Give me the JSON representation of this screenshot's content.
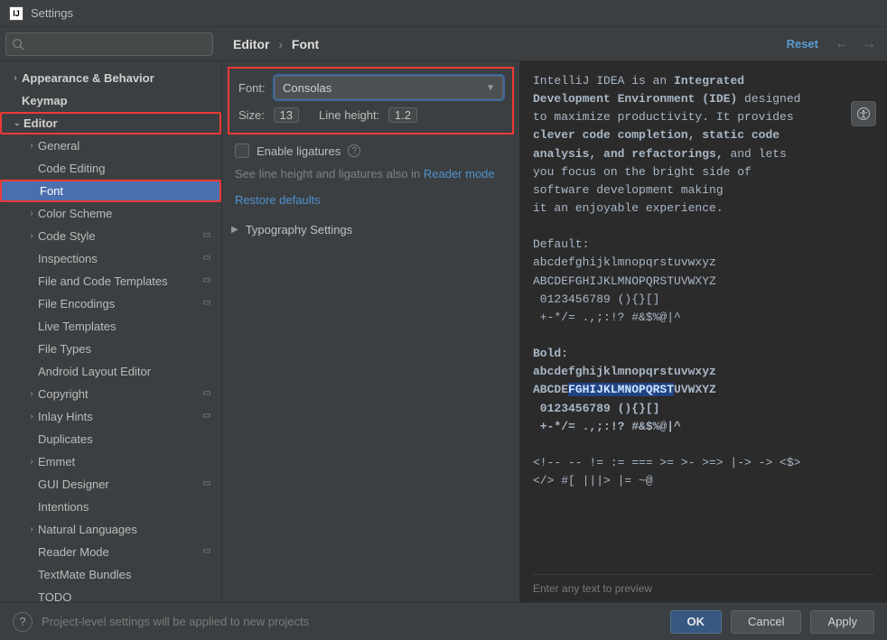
{
  "window": {
    "title": "Settings"
  },
  "breadcrumb": {
    "part1": "Editor",
    "sep": "›",
    "part2": "Font"
  },
  "actions": {
    "reset": "Reset"
  },
  "sidebar": {
    "items": [
      {
        "label": "Appearance & Behavior",
        "chev": "›",
        "lvl": 0,
        "bold": true
      },
      {
        "label": "Keymap",
        "chev": "",
        "lvl": 0,
        "bold": true
      },
      {
        "label": "Editor",
        "chev": "⌄",
        "lvl": 0,
        "bold": true,
        "hl": true
      },
      {
        "label": "General",
        "chev": "›",
        "lvl": 1
      },
      {
        "label": "Code Editing",
        "chev": "",
        "lvl": 1
      },
      {
        "label": "Font",
        "chev": "",
        "lvl": 1,
        "sel": true,
        "hl": true
      },
      {
        "label": "Color Scheme",
        "chev": "›",
        "lvl": 1
      },
      {
        "label": "Code Style",
        "chev": "›",
        "lvl": 1,
        "pill": true
      },
      {
        "label": "Inspections",
        "chev": "",
        "lvl": 1,
        "pill": true
      },
      {
        "label": "File and Code Templates",
        "chev": "",
        "lvl": 1,
        "pill": true
      },
      {
        "label": "File Encodings",
        "chev": "",
        "lvl": 1,
        "pill": true
      },
      {
        "label": "Live Templates",
        "chev": "",
        "lvl": 1
      },
      {
        "label": "File Types",
        "chev": "",
        "lvl": 1
      },
      {
        "label": "Android Layout Editor",
        "chev": "",
        "lvl": 1
      },
      {
        "label": "Copyright",
        "chev": "›",
        "lvl": 1,
        "pill": true
      },
      {
        "label": "Inlay Hints",
        "chev": "›",
        "lvl": 1,
        "pill": true
      },
      {
        "label": "Duplicates",
        "chev": "",
        "lvl": 1
      },
      {
        "label": "Emmet",
        "chev": "›",
        "lvl": 1
      },
      {
        "label": "GUI Designer",
        "chev": "",
        "lvl": 1,
        "pill": true
      },
      {
        "label": "Intentions",
        "chev": "",
        "lvl": 1
      },
      {
        "label": "Natural Languages",
        "chev": "›",
        "lvl": 1
      },
      {
        "label": "Reader Mode",
        "chev": "",
        "lvl": 1,
        "pill": true
      },
      {
        "label": "TextMate Bundles",
        "chev": "",
        "lvl": 1
      },
      {
        "label": "TODO",
        "chev": "",
        "lvl": 1
      }
    ]
  },
  "form": {
    "font_label": "Font:",
    "font_value": "Consolas",
    "size_label": "Size:",
    "size_value": "13",
    "lineheight_label": "Line height:",
    "lineheight_value": "1.2",
    "ligatures_label": "Enable ligatures",
    "hint_prefix": "See line height and ligatures also in ",
    "hint_link": "Reader mode",
    "restore": "Restore defaults",
    "typography": "Typography Settings"
  },
  "preview": {
    "hint": "Enter any text to preview",
    "p1a": "IntelliJ IDEA is an ",
    "p1b": "Integrated",
    "p2a": "Development Environment (IDE)",
    "p2b": " designed",
    "p3": "to maximize productivity. It provides",
    "p4a": "clever code completion, static code",
    "p5a": "analysis, and refactorings,",
    "p5b": " and lets",
    "p6": "you focus on the bright side of",
    "p7": "software development making",
    "p8": "it an enjoyable experience.",
    "def": "Default:",
    "l1": "abcdefghijklmnopqrstuvwxyz",
    "l2": "ABCDEFGHIJKLMNOPQRSTUVWXYZ",
    "l3": " 0123456789 (){}[]",
    "l4": " +-*/= .,;:!? #&$%@|^",
    "bold": "Bold:",
    "b1": "abcdefghijklmnopqrstuvwxyz",
    "b2a": "ABCDE",
    "b2hl": "FGHIJKLMNOPQRST",
    "b2b": "UVWXYZ",
    "b3": " 0123456789 (){}[]",
    "b4": " +-*/= .,;:!? #&$%@|^",
    "sym1": "<!-- -- != := === >= >- >=> |-> -> <$>",
    "sym2": "</> #[ |||> |= ~@"
  },
  "footer": {
    "note": "Project-level settings will be applied to new projects",
    "ok": "OK",
    "cancel": "Cancel",
    "apply": "Apply"
  }
}
